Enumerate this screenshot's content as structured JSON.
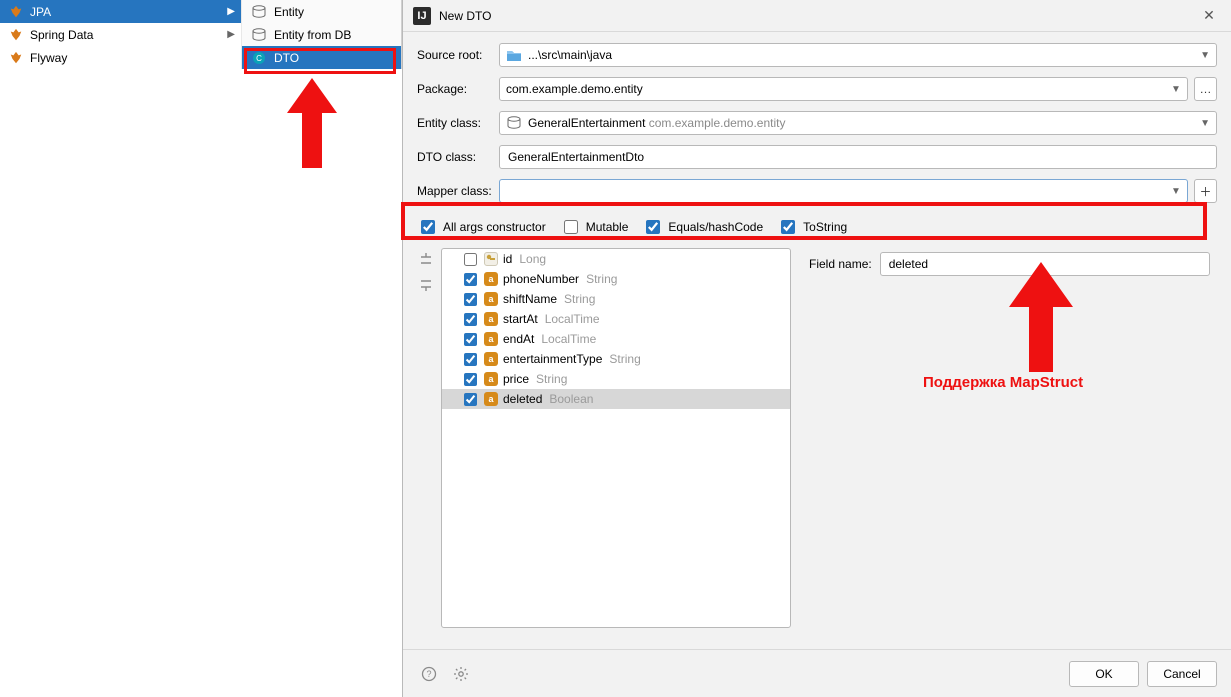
{
  "leftnav": {
    "items": [
      {
        "label": "JPA",
        "active": true
      },
      {
        "label": "Spring Data",
        "active": false
      },
      {
        "label": "Flyway",
        "active": false
      }
    ]
  },
  "midnav": {
    "items": [
      {
        "label": "Entity",
        "kind": "db",
        "selected": false
      },
      {
        "label": "Entity from DB",
        "kind": "db",
        "selected": false
      },
      {
        "label": "DTO",
        "kind": "dto",
        "selected": true
      }
    ]
  },
  "dialog": {
    "title": "New DTO",
    "labels": {
      "source_root": "Source root:",
      "package": "Package:",
      "entity_class": "Entity class:",
      "dto_class": "DTO class:",
      "mapper_class": "Mapper class:",
      "field_name": "Field name:"
    },
    "values": {
      "source_root": "...\\src\\main\\java",
      "package": "com.example.demo.entity",
      "entity_class_name": "GeneralEntertainment",
      "entity_class_pkg": "com.example.demo.entity",
      "dto_class": "GeneralEntertainmentDto",
      "mapper_class": "",
      "field_name": "deleted"
    },
    "checks": {
      "all_args": {
        "label": "All args constructor",
        "checked": true
      },
      "mutable": {
        "label": "Mutable",
        "checked": false
      },
      "equals": {
        "label": "Equals/hashCode",
        "checked": true
      },
      "tostring": {
        "label": "ToString",
        "checked": true
      }
    },
    "fields": [
      {
        "name": "id",
        "type": "Long",
        "checked": false,
        "id": true,
        "selected": false
      },
      {
        "name": "phoneNumber",
        "type": "String",
        "checked": true,
        "id": false,
        "selected": false
      },
      {
        "name": "shiftName",
        "type": "String",
        "checked": true,
        "id": false,
        "selected": false
      },
      {
        "name": "startAt",
        "type": "LocalTime",
        "checked": true,
        "id": false,
        "selected": false
      },
      {
        "name": "endAt",
        "type": "LocalTime",
        "checked": true,
        "id": false,
        "selected": false
      },
      {
        "name": "entertainmentType",
        "type": "String",
        "checked": true,
        "id": false,
        "selected": false
      },
      {
        "name": "price",
        "type": "String",
        "checked": true,
        "id": false,
        "selected": false
      },
      {
        "name": "deleted",
        "type": "Boolean",
        "checked": true,
        "id": false,
        "selected": true
      }
    ],
    "buttons": {
      "ok": "OK",
      "cancel": "Cancel"
    }
  },
  "annotation": {
    "text": "Поддержка MapStruct"
  }
}
